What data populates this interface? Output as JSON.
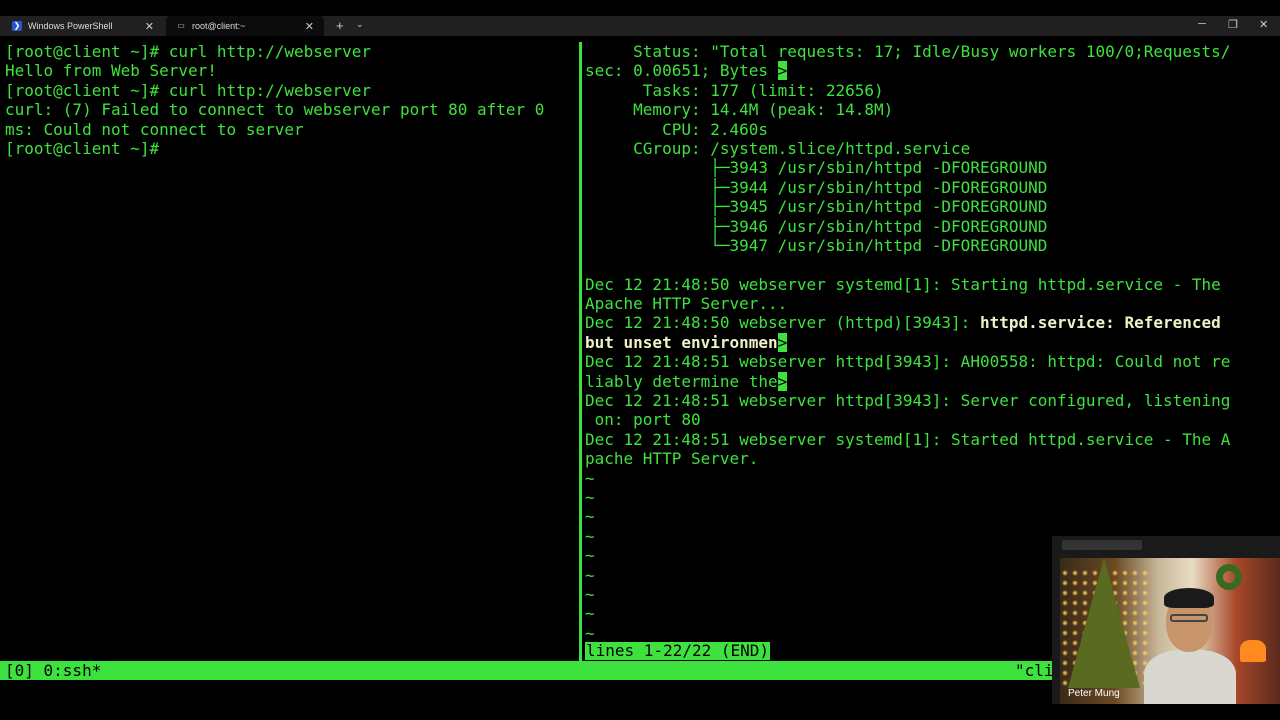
{
  "tabs": [
    {
      "label": "Windows PowerShell",
      "icon": "powershell-icon",
      "close": "✕"
    },
    {
      "label": "root@client:~",
      "icon": "terminal-icon",
      "close": "✕"
    }
  ],
  "tabbar": {
    "new_tab": "+",
    "dropdown": "⌄"
  },
  "window_controls": {
    "minimize": "─",
    "maximize": "❐",
    "close": "✕"
  },
  "left_pane": {
    "lines": [
      "[root@client ~]# curl http://webserver",
      "Hello from Web Server!",
      "[root@client ~]# curl http://webserver",
      "curl: (7) Failed to connect to webserver port 80 after 0",
      "ms: Could not connect to server",
      "[root@client ~]#"
    ]
  },
  "right_pane": {
    "status": {
      "l1": "     Status: \"Total requests: 17; Idle/Busy workers 100/0;Requests/",
      "l2a": "sec: 0.00651; Bytes ",
      "l2cursor": ">",
      "tasks": "      Tasks: 177 (limit: 22656)",
      "memory": "     Memory: 14.4M (peak: 14.8M)",
      "cpu": "        CPU: 2.460s",
      "cgroup": "     CGroup: /system.slice/httpd.service"
    },
    "processes": [
      "             ├─3943 /usr/sbin/httpd -DFOREGROUND",
      "             ├─3944 /usr/sbin/httpd -DFOREGROUND",
      "             ├─3945 /usr/sbin/httpd -DFOREGROUND",
      "             ├─3946 /usr/sbin/httpd -DFOREGROUND",
      "             └─3947 /usr/sbin/httpd -DFOREGROUND"
    ],
    "log": {
      "e1a": "Dec 12 21:48:50 webserver systemd[1]: Starting httpd.service - The",
      "e1b": "Apache HTTP Server...",
      "e2a_plain": "Dec 12 21:48:50 webserver (httpd)[3943]: ",
      "e2a_bold": "httpd.service: Referenced",
      "e2b_bold": "but unset environmen",
      "e2b_cursor": ">",
      "e3a": "Dec 12 21:48:51 webserver httpd[3943]: AH00558: httpd: Could not re",
      "e3b": "liably determine the",
      "e3b_cursor": ">",
      "e4a": "Dec 12 21:48:51 webserver httpd[3943]: Server configured, listening",
      "e4b": " on: port 80",
      "e5a": "Dec 12 21:48:51 webserver systemd[1]: Started httpd.service - The A",
      "e5b": "pache HTTP Server."
    },
    "tildes": [
      "~",
      "~",
      "~",
      "~",
      "~",
      "~",
      "~",
      "~",
      "~"
    ],
    "pager": "lines 1-22/22 (END)"
  },
  "statusbar": {
    "left": "[0] 0:ssh*",
    "right": "\"cli"
  },
  "webcam": {
    "name": "Peter Mung"
  },
  "colors": {
    "terminal_green": "#3ee23e",
    "background": "#000000"
  }
}
